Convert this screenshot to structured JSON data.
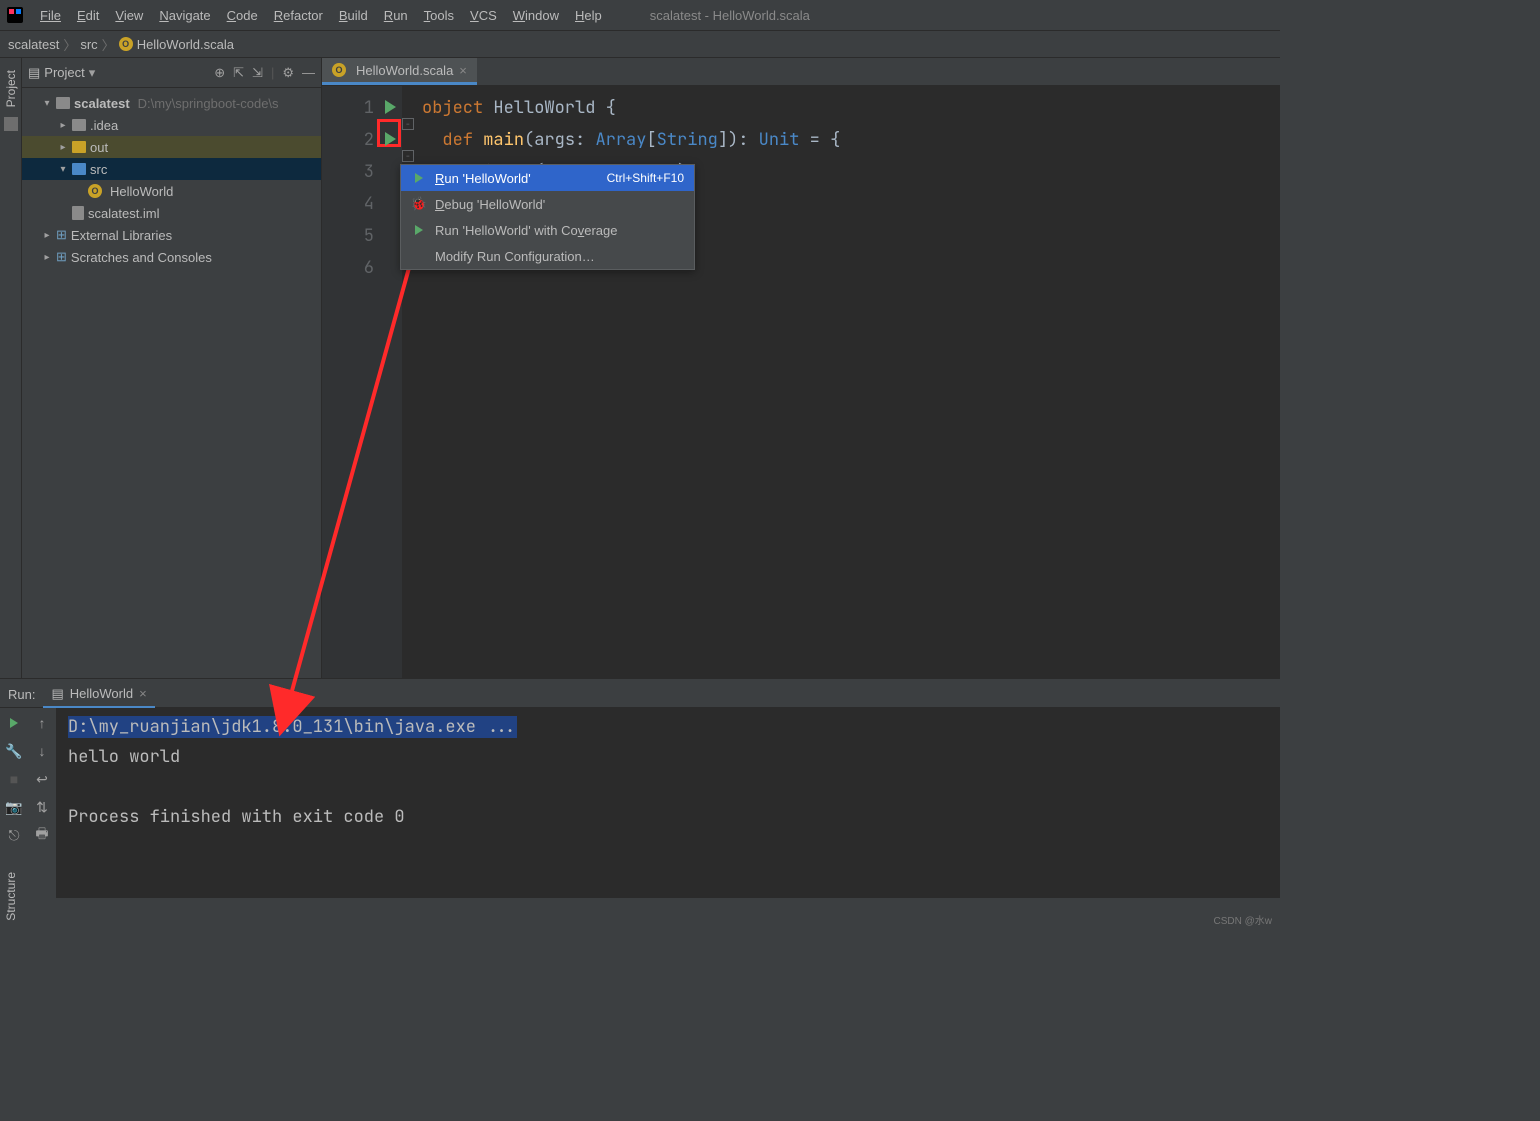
{
  "window_title": "scalatest - HelloWorld.scala",
  "menu": [
    "File",
    "Edit",
    "View",
    "Navigate",
    "Code",
    "Refactor",
    "Build",
    "Run",
    "Tools",
    "VCS",
    "Window",
    "Help"
  ],
  "breadcrumb": {
    "root": "scalatest",
    "mid": "src",
    "file": "HelloWorld.scala"
  },
  "project_panel": {
    "title": "Project",
    "root": "scalatest",
    "root_path": "D:\\my\\springboot-code\\s",
    "items": [
      {
        "name": ".idea",
        "type": "folder-grey",
        "depth": 2,
        "expand": ">"
      },
      {
        "name": "out",
        "type": "folder",
        "depth": 2,
        "expand": ">",
        "hl": true
      },
      {
        "name": "src",
        "type": "folder-blue",
        "depth": 2,
        "expand": "v",
        "sel": true
      },
      {
        "name": "HelloWorld",
        "type": "o",
        "depth": 3
      },
      {
        "name": "scalatest.iml",
        "type": "file",
        "depth": 2
      }
    ],
    "extra": [
      {
        "name": "External Libraries",
        "icon": "lib"
      },
      {
        "name": "Scratches and Consoles",
        "icon": "scratch"
      }
    ]
  },
  "sidebar_labels": {
    "project": "Project",
    "structure": "Structure"
  },
  "editor": {
    "tab": "HelloWorld.scala",
    "lines": [
      {
        "n": "1",
        "run": true,
        "seg": [
          [
            "kw",
            "object "
          ],
          [
            "pl",
            "HelloWorld {"
          ]
        ]
      },
      {
        "n": "2",
        "run": true,
        "seg": [
          [
            "pl",
            "  "
          ],
          [
            "kw",
            "def "
          ],
          [
            "fn",
            "main"
          ],
          [
            "pl",
            "(args: "
          ],
          [
            "ty",
            "Array"
          ],
          [
            "pl",
            "["
          ],
          [
            "ty",
            "String"
          ],
          [
            "pl",
            "]): "
          ],
          [
            "ty",
            "Unit"
          ],
          [
            "pl",
            " = {"
          ]
        ]
      },
      {
        "n": "3",
        "seg": [
          [
            "pl",
            "    println("
          ],
          [
            "str",
            "\"hello world\""
          ],
          [
            "pl",
            ")"
          ]
        ]
      },
      {
        "n": "4",
        "seg": [
          [
            "pl",
            "  }"
          ]
        ]
      },
      {
        "n": "5",
        "seg": [
          [
            "pl",
            "}"
          ]
        ]
      },
      {
        "n": "6",
        "seg": []
      }
    ]
  },
  "context_menu": [
    {
      "icon": "run",
      "label": "Run 'HelloWorld'",
      "shortcut": "Ctrl+Shift+F10",
      "sel": true,
      "u": 0
    },
    {
      "icon": "bug",
      "label": "Debug 'HelloWorld'",
      "u": 0
    },
    {
      "icon": "cov",
      "label": "Run 'HelloWorld' with Coverage",
      "u": 24
    },
    {
      "icon": "",
      "label": "Modify Run Configuration…"
    }
  ],
  "run_panel": {
    "label": "Run:",
    "tab": "HelloWorld",
    "lines": [
      {
        "text": "D:\\my_ruanjian\\jdk1.8.0_131\\bin\\java.exe ...",
        "cmd": true
      },
      {
        "text": "hello world"
      },
      {
        "text": ""
      },
      {
        "text": "Process finished with exit code 0"
      }
    ]
  },
  "watermark": "CSDN @水w"
}
